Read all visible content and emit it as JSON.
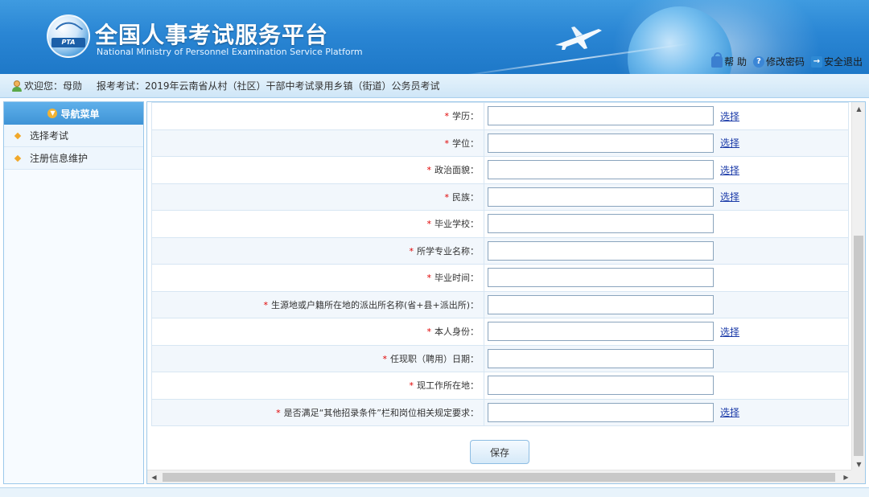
{
  "header": {
    "logo_text": "PTA",
    "title": "全国人事考试服务平台",
    "subtitle": "National Ministry of Personnel Examination Service Platform",
    "links": {
      "help": "帮 助",
      "change_password": "修改密码",
      "logout": "安全退出"
    }
  },
  "welcome": {
    "greeting": "欢迎您：母勋",
    "exam": "报考考试：2019年云南省从村（社区）干部中考试录用乡镇（街道）公务员考试"
  },
  "sidebar": {
    "header": "导航菜单",
    "items": [
      {
        "label": "选择考试"
      },
      {
        "label": "注册信息维护"
      }
    ]
  },
  "form": {
    "required_mark": "*",
    "rows": [
      {
        "label": "学历：",
        "value": "",
        "pick": "选择"
      },
      {
        "label": "学位：",
        "value": "",
        "pick": "选择"
      },
      {
        "label": "政治面貌：",
        "value": "",
        "pick": "选择"
      },
      {
        "label": "民族：",
        "value": "",
        "pick": "选择"
      },
      {
        "label": "毕业学校：",
        "value": "",
        "pick": ""
      },
      {
        "label": "所学专业名称：",
        "value": "",
        "pick": ""
      },
      {
        "label": "毕业时间：",
        "value": "",
        "pick": ""
      },
      {
        "label": "生源地或户籍所在地的派出所名称(省+县+派出所)：",
        "value": "",
        "pick": ""
      },
      {
        "label": "本人身份：",
        "value": "",
        "pick": "选择"
      },
      {
        "label": "任现职（聘用）日期：",
        "value": "",
        "pick": ""
      },
      {
        "label": "现工作所在地：",
        "value": "",
        "pick": ""
      },
      {
        "label": "是否满足“其他招录条件”栏和岗位相关规定要求：",
        "value": "",
        "pick": "选择"
      }
    ],
    "save_label": "保存"
  },
  "colors": {
    "header_blue": "#2a86d4",
    "required_red": "#e00000",
    "link_blue": "#1a3aa8",
    "nav_accent": "#f1a82a"
  }
}
